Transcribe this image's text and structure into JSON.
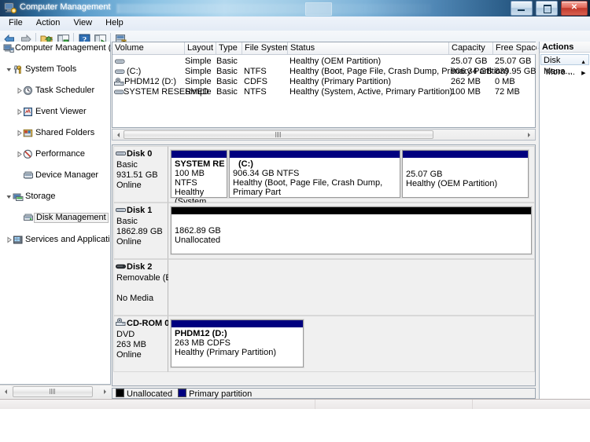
{
  "window": {
    "title": "Computer Management",
    "icon": "computer-management-icon",
    "buttons": {
      "minimize": "–",
      "maximize": "❐",
      "close": "✕"
    }
  },
  "menu": {
    "items": [
      "File",
      "Action",
      "View",
      "Help"
    ]
  },
  "toolbar": {
    "items": [
      {
        "name": "back-arrow-icon"
      },
      {
        "name": "forward-arrow-icon"
      },
      {
        "name": "up-folder-icon"
      },
      {
        "name": "show-hide-console-tree-icon"
      },
      {
        "name": "help-icon"
      },
      {
        "name": "properties-icon"
      },
      {
        "name": "refresh-icon"
      }
    ]
  },
  "tree": {
    "nodes": [
      {
        "label": "Computer Management (Local",
        "indent": 0,
        "icon": "computer-icon",
        "expander": "",
        "selected": false
      },
      {
        "label": "System Tools",
        "indent": 1,
        "icon": "system-tools-icon",
        "expander": "down",
        "selected": false
      },
      {
        "label": "Task Scheduler",
        "indent": 2,
        "icon": "clock-icon",
        "expander": "right",
        "selected": false
      },
      {
        "label": "Event Viewer",
        "indent": 2,
        "icon": "event-viewer-icon",
        "expander": "right",
        "selected": false
      },
      {
        "label": "Shared Folders",
        "indent": 2,
        "icon": "shared-folders-icon",
        "expander": "right",
        "selected": false
      },
      {
        "label": "Performance",
        "indent": 2,
        "icon": "performance-icon",
        "expander": "right",
        "selected": false
      },
      {
        "label": "Device Manager",
        "indent": 2,
        "icon": "device-manager-icon",
        "expander": "",
        "selected": false
      },
      {
        "label": "Storage",
        "indent": 1,
        "icon": "storage-icon",
        "expander": "down",
        "selected": false
      },
      {
        "label": "Disk Management",
        "indent": 2,
        "icon": "disk-management-icon",
        "expander": "",
        "selected": true
      },
      {
        "label": "Services and Applications",
        "indent": 1,
        "icon": "services-icon",
        "expander": "right",
        "selected": false
      }
    ]
  },
  "volume_list": {
    "columns": [
      "Volume",
      "Layout",
      "Type",
      "File System",
      "Status",
      "Capacity",
      "Free Space"
    ],
    "rows": [
      {
        "icon": "volume-icon",
        "volume": "",
        "layout": "Simple",
        "type": "Basic",
        "fs": "",
        "status": "Healthy (OEM Partition)",
        "capacity": "25.07 GB",
        "free": "25.07 GB"
      },
      {
        "icon": "volume-icon",
        "volume": "(C:)",
        "layout": "Simple",
        "type": "Basic",
        "fs": "NTFS",
        "status": "Healthy (Boot, Page File, Crash Dump, Primary Partition)",
        "capacity": "906.34 GB",
        "free": "839.95 GB"
      },
      {
        "icon": "cdrom-icon",
        "volume": "PHDM12 (D:)",
        "layout": "Simple",
        "type": "Basic",
        "fs": "CDFS",
        "status": "Healthy (Primary Partition)",
        "capacity": "262 MB",
        "free": "0 MB"
      },
      {
        "icon": "volume-icon",
        "volume": "SYSTEM RESERVED",
        "layout": "Simple",
        "type": "Basic",
        "fs": "NTFS",
        "status": "Healthy (System, Active, Primary Partition)",
        "capacity": "100 MB",
        "free": "72 MB"
      }
    ]
  },
  "disks": [
    {
      "name": "Disk 0",
      "icon": "disk-icon",
      "lines": [
        "Basic",
        "931.51 GB",
        "Online"
      ],
      "partitions": [
        {
          "name": "SYSTEM RESERV",
          "size_fs": "100 MB NTFS",
          "status": "Healthy (System",
          "color": "#00007f",
          "blank_first": false
        },
        {
          "name": "(C:)",
          "size_fs": "906.34 GB NTFS",
          "status": "Healthy (Boot, Page File, Crash Dump, Primary Part",
          "color": "#00007f",
          "blank_first": false
        },
        {
          "name": "",
          "size_fs": "25.07 GB",
          "status": "Healthy (OEM Partition)",
          "color": "#00007f",
          "blank_first": true
        }
      ]
    },
    {
      "name": "Disk 1",
      "icon": "disk-icon",
      "lines": [
        "Basic",
        "1862.89 GB",
        "Online"
      ],
      "partitions": [
        {
          "name": "",
          "size_fs": "1862.89 GB",
          "status": "Unallocated",
          "color": "#000000",
          "blank_first": true
        }
      ]
    },
    {
      "name": "Disk 2",
      "icon": "removable-icon",
      "lines": [
        "Removable (E:)",
        "",
        "No Media"
      ],
      "partitions": []
    },
    {
      "name": "CD-ROM 0",
      "icon": "cdrom-icon",
      "lines": [
        "DVD",
        "263 MB",
        "Online"
      ],
      "partitions": [
        {
          "name": "PHDM12  (D:)",
          "size_fs": "263 MB CDFS",
          "status": "Healthy (Primary Partition)",
          "color": "#00007f",
          "blank_first": false
        }
      ]
    }
  ],
  "legend": {
    "items": [
      {
        "label": "Unallocated",
        "color": "#000000"
      },
      {
        "label": "Primary partition",
        "color": "#00007f"
      }
    ]
  },
  "actions": {
    "header": "Actions",
    "item": "Disk Mana...",
    "more": "More ...",
    "collapse_glyph": "▲",
    "more_glyph": "▶"
  },
  "colors": {
    "primary_partition": "#00007f",
    "unallocated": "#000000",
    "title_bar_accent": "#3b7cb0"
  }
}
